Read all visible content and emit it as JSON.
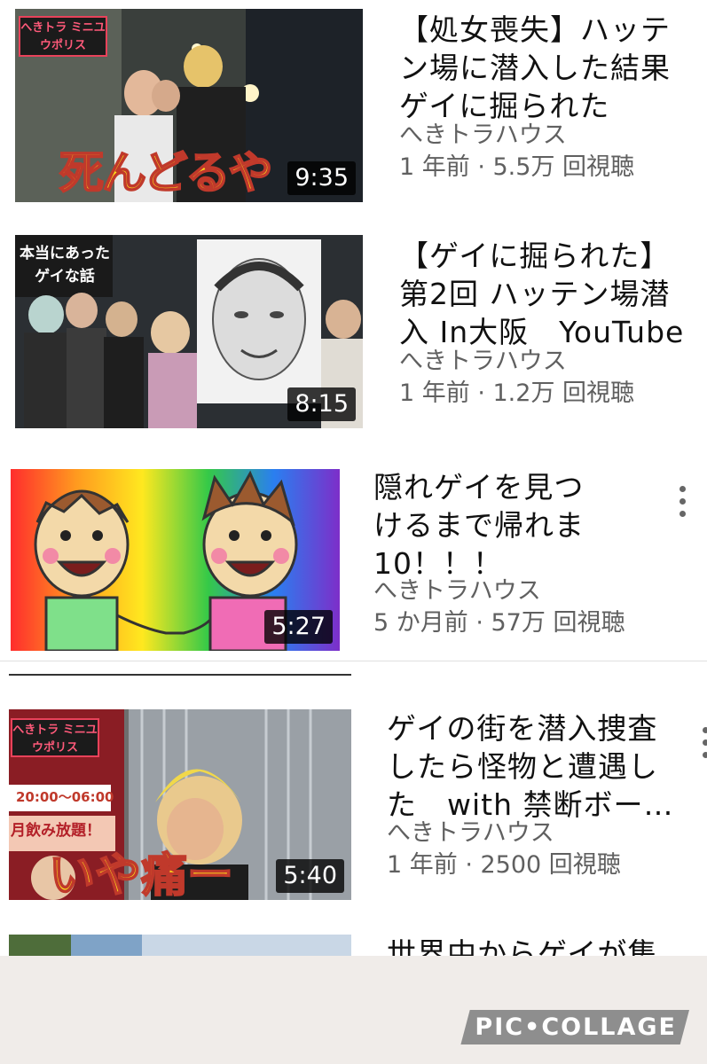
{
  "videos": [
    {
      "title": "【処女喪失】ハッテン場に潜入した結果ゲイに掘られた",
      "title_lines": [
        "【処女喪失】ハッテ",
        "ン場に潜入した結果",
        "ゲイに掘られた"
      ],
      "channel": "へきトラハウス",
      "meta": "1 年前 · 5.5万 回視聴",
      "duration": "9:35",
      "thumb_badge": "へきトラ ミニユウポリス",
      "thumb_caption": "死んどるや"
    },
    {
      "title_lines": [
        "【ゲイに掘られた】",
        "第2回 ハッテン場潜",
        "入 In大阪　YouTube"
      ],
      "channel": "へきトラハウス",
      "meta": "1 年前 · 1.2万 回視聴",
      "duration": "8:15",
      "thumb_badge": "本当にあったゲイな話"
    },
    {
      "title_lines": [
        "隠れゲイを見つ",
        "けるまで帰れま",
        "10！！！"
      ],
      "channel": "へきトラハウス",
      "meta": "5 か月前 · 57万 回視聴",
      "duration": "5:27"
    },
    {
      "title_lines": [
        "ゲイの街を潜入捜査",
        "したら怪物と遭遇し",
        "た　with 禁断ボー…"
      ],
      "channel": "へきトラハウス",
      "meta": "1 年前 · 2500 回視聴",
      "duration": "5:40",
      "thumb_badge": "へきトラ ミニユウポリス",
      "thumb_caption": "いや痛ー",
      "thumb_sign_1": "20:00～06:00",
      "thumb_sign_2": "月飲み放題！"
    },
    {
      "title_lines": [
        "世界中からゲイが集"
      ]
    }
  ],
  "branding": {
    "label": "PIC•COLLAGE"
  }
}
